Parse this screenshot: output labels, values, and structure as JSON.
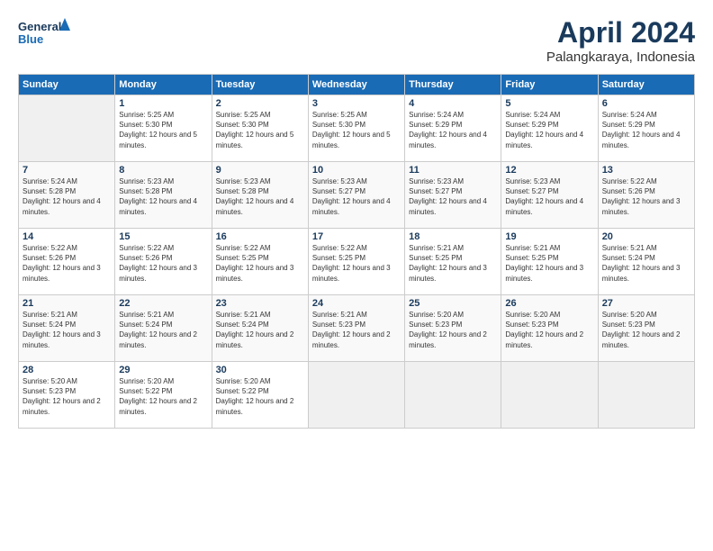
{
  "logo": {
    "line1": "General",
    "line2": "Blue"
  },
  "title": "April 2024",
  "subtitle": "Palangkaraya, Indonesia",
  "weekdays": [
    "Sunday",
    "Monday",
    "Tuesday",
    "Wednesday",
    "Thursday",
    "Friday",
    "Saturday"
  ],
  "weeks": [
    [
      {
        "day": "",
        "empty": true
      },
      {
        "day": "1",
        "sunrise": "5:25 AM",
        "sunset": "5:30 PM",
        "daylight": "12 hours and 5 minutes."
      },
      {
        "day": "2",
        "sunrise": "5:25 AM",
        "sunset": "5:30 PM",
        "daylight": "12 hours and 5 minutes."
      },
      {
        "day": "3",
        "sunrise": "5:25 AM",
        "sunset": "5:30 PM",
        "daylight": "12 hours and 5 minutes."
      },
      {
        "day": "4",
        "sunrise": "5:24 AM",
        "sunset": "5:29 PM",
        "daylight": "12 hours and 4 minutes."
      },
      {
        "day": "5",
        "sunrise": "5:24 AM",
        "sunset": "5:29 PM",
        "daylight": "12 hours and 4 minutes."
      },
      {
        "day": "6",
        "sunrise": "5:24 AM",
        "sunset": "5:29 PM",
        "daylight": "12 hours and 4 minutes."
      }
    ],
    [
      {
        "day": "7",
        "sunrise": "5:24 AM",
        "sunset": "5:28 PM",
        "daylight": "12 hours and 4 minutes."
      },
      {
        "day": "8",
        "sunrise": "5:23 AM",
        "sunset": "5:28 PM",
        "daylight": "12 hours and 4 minutes."
      },
      {
        "day": "9",
        "sunrise": "5:23 AM",
        "sunset": "5:28 PM",
        "daylight": "12 hours and 4 minutes."
      },
      {
        "day": "10",
        "sunrise": "5:23 AM",
        "sunset": "5:27 PM",
        "daylight": "12 hours and 4 minutes."
      },
      {
        "day": "11",
        "sunrise": "5:23 AM",
        "sunset": "5:27 PM",
        "daylight": "12 hours and 4 minutes."
      },
      {
        "day": "12",
        "sunrise": "5:23 AM",
        "sunset": "5:27 PM",
        "daylight": "12 hours and 4 minutes."
      },
      {
        "day": "13",
        "sunrise": "5:22 AM",
        "sunset": "5:26 PM",
        "daylight": "12 hours and 3 minutes."
      }
    ],
    [
      {
        "day": "14",
        "sunrise": "5:22 AM",
        "sunset": "5:26 PM",
        "daylight": "12 hours and 3 minutes."
      },
      {
        "day": "15",
        "sunrise": "5:22 AM",
        "sunset": "5:26 PM",
        "daylight": "12 hours and 3 minutes."
      },
      {
        "day": "16",
        "sunrise": "5:22 AM",
        "sunset": "5:25 PM",
        "daylight": "12 hours and 3 minutes."
      },
      {
        "day": "17",
        "sunrise": "5:22 AM",
        "sunset": "5:25 PM",
        "daylight": "12 hours and 3 minutes."
      },
      {
        "day": "18",
        "sunrise": "5:21 AM",
        "sunset": "5:25 PM",
        "daylight": "12 hours and 3 minutes."
      },
      {
        "day": "19",
        "sunrise": "5:21 AM",
        "sunset": "5:25 PM",
        "daylight": "12 hours and 3 minutes."
      },
      {
        "day": "20",
        "sunrise": "5:21 AM",
        "sunset": "5:24 PM",
        "daylight": "12 hours and 3 minutes."
      }
    ],
    [
      {
        "day": "21",
        "sunrise": "5:21 AM",
        "sunset": "5:24 PM",
        "daylight": "12 hours and 3 minutes."
      },
      {
        "day": "22",
        "sunrise": "5:21 AM",
        "sunset": "5:24 PM",
        "daylight": "12 hours and 2 minutes."
      },
      {
        "day": "23",
        "sunrise": "5:21 AM",
        "sunset": "5:24 PM",
        "daylight": "12 hours and 2 minutes."
      },
      {
        "day": "24",
        "sunrise": "5:21 AM",
        "sunset": "5:23 PM",
        "daylight": "12 hours and 2 minutes."
      },
      {
        "day": "25",
        "sunrise": "5:20 AM",
        "sunset": "5:23 PM",
        "daylight": "12 hours and 2 minutes."
      },
      {
        "day": "26",
        "sunrise": "5:20 AM",
        "sunset": "5:23 PM",
        "daylight": "12 hours and 2 minutes."
      },
      {
        "day": "27",
        "sunrise": "5:20 AM",
        "sunset": "5:23 PM",
        "daylight": "12 hours and 2 minutes."
      }
    ],
    [
      {
        "day": "28",
        "sunrise": "5:20 AM",
        "sunset": "5:23 PM",
        "daylight": "12 hours and 2 minutes."
      },
      {
        "day": "29",
        "sunrise": "5:20 AM",
        "sunset": "5:22 PM",
        "daylight": "12 hours and 2 minutes."
      },
      {
        "day": "30",
        "sunrise": "5:20 AM",
        "sunset": "5:22 PM",
        "daylight": "12 hours and 2 minutes."
      },
      {
        "day": "",
        "empty": true
      },
      {
        "day": "",
        "empty": true
      },
      {
        "day": "",
        "empty": true
      },
      {
        "day": "",
        "empty": true
      }
    ]
  ]
}
